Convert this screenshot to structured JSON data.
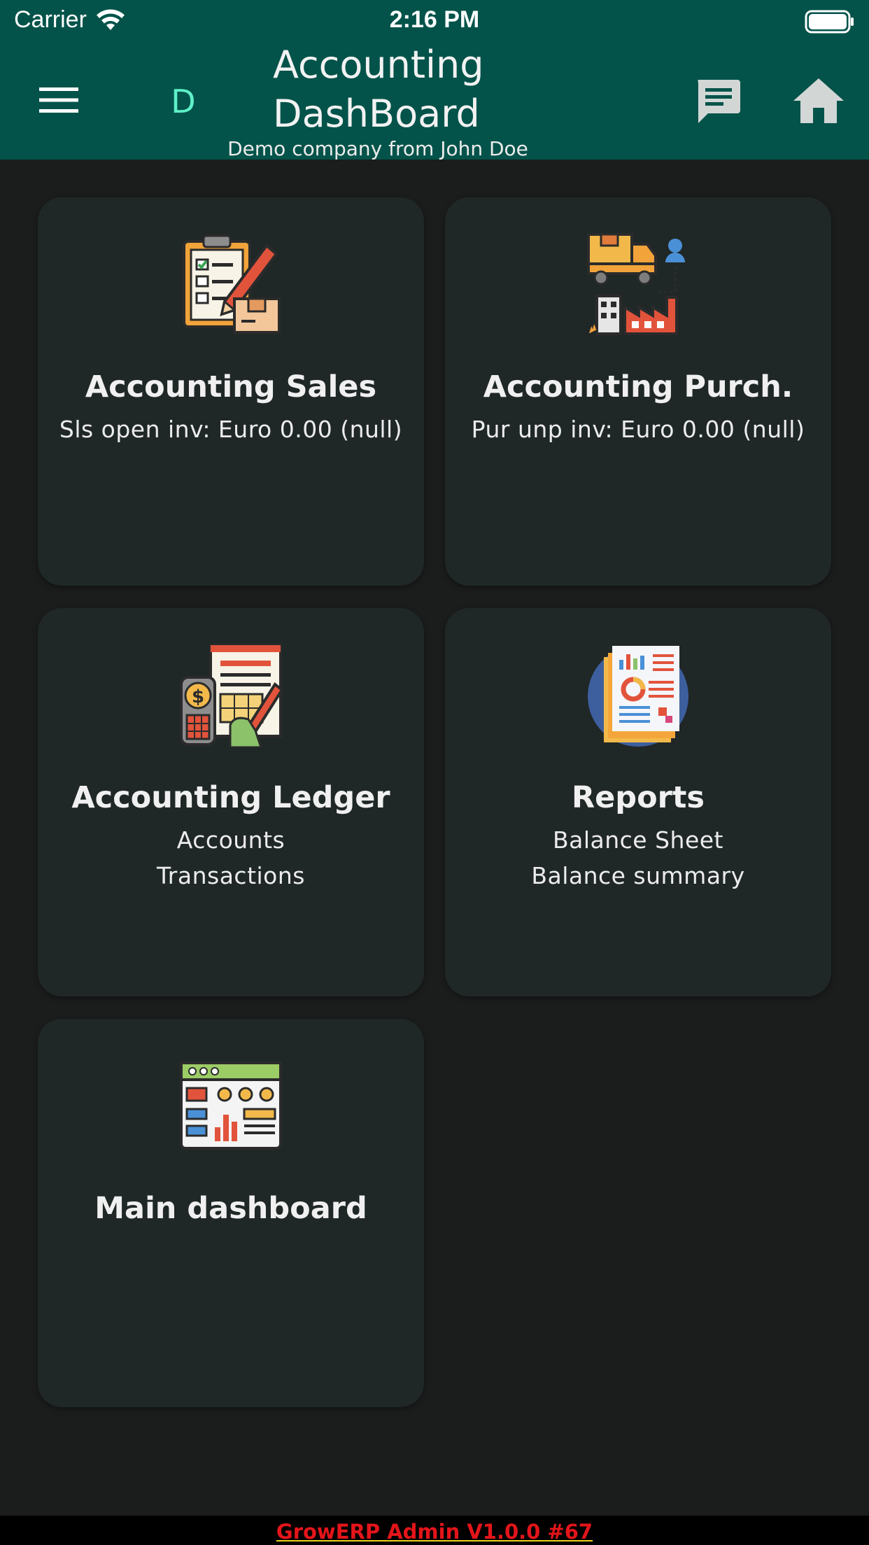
{
  "status_bar": {
    "carrier": "Carrier",
    "time": "2:16 PM"
  },
  "app_bar": {
    "avatar_letter": "D",
    "title_line1": "Accounting",
    "title_line2": "DashBoard",
    "subtitle": "Demo company from John Doe",
    "background_color": "#03534a",
    "avatar_color": "#5ef0c8"
  },
  "cards": [
    {
      "title": "Accounting Sales",
      "lines": [
        "Sls open inv: Euro 0.00 (null)"
      ],
      "icon": "checklist-pencil-icon"
    },
    {
      "title": "Accounting Purch.",
      "lines": [
        "Pur unp inv: Euro 0.00 (null)"
      ],
      "icon": "truck-factory-icon"
    },
    {
      "title": "Accounting Ledger",
      "lines": [
        "Accounts",
        "Transactions"
      ],
      "icon": "ledger-calculator-icon"
    },
    {
      "title": "Reports",
      "lines": [
        "Balance Sheet",
        "Balance summary"
      ],
      "icon": "report-chart-icon"
    },
    {
      "title": "Main dashboard",
      "lines": [],
      "icon": "dashboard-window-icon"
    }
  ],
  "footer": {
    "text": "GrowERP Admin V1.0.0 #67",
    "text_color": "#e3151a"
  }
}
